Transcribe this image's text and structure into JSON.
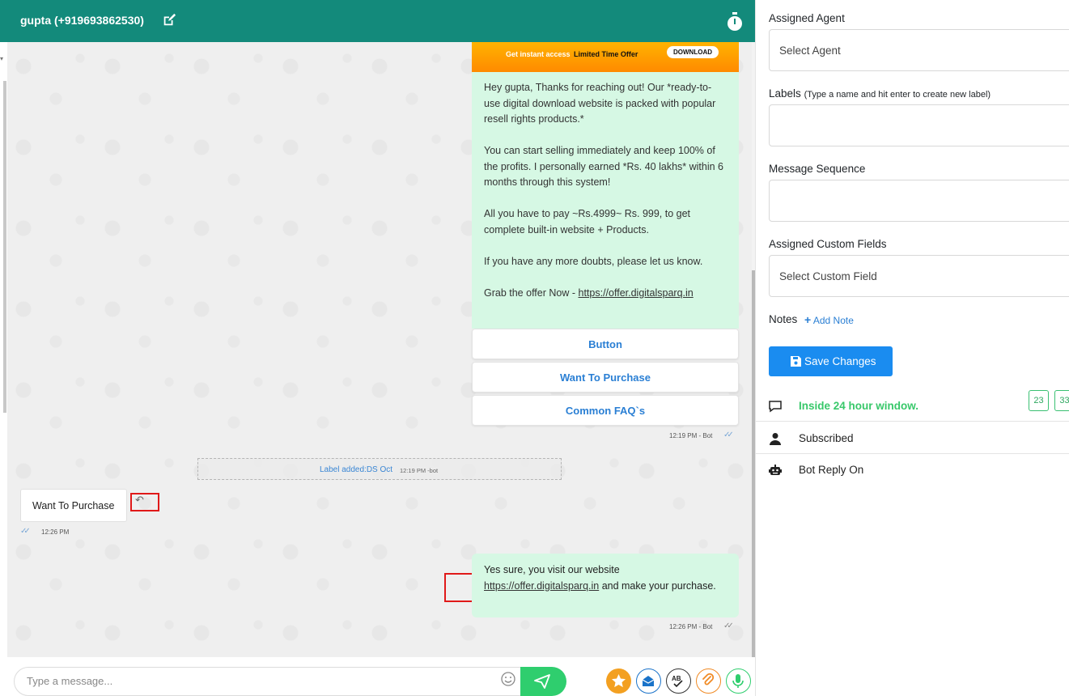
{
  "header": {
    "contact": "gupta (+919693862530)",
    "edit_icon": "edit-icon",
    "timer_icon": "stopwatch-icon"
  },
  "bot_template": {
    "banner_left": "Get instant access",
    "banner_mid": "Limited Time Offer",
    "banner_button": "DOWNLOAD",
    "para1": "Hey gupta, Thanks for reaching out! Our *ready-to-use digital download website is packed with popular resell rights products.*",
    "para2": "You can start selling immediately and keep 100% of the profits. I personally earned *Rs. 40 lakhs* within 6 months through this system!",
    "para3": "All you have to pay ~Rs.4999~ Rs. 999, to get complete built-in website + Products.",
    "para4": "If you have any more doubts, please let us know.",
    "para5_prefix": "Grab the offer Now - ",
    "para5_link": "https://offer.digitalsparq.in",
    "buttons": [
      "Button",
      "Want To Purchase",
      "Common FAQ`s"
    ],
    "time": "12:19 PM - Bot"
  },
  "label_note": {
    "text": "Label added:DS Oct",
    "time": "12:19 PM -bot"
  },
  "incoming": {
    "text": "Want To Purchase",
    "time": "12:26 PM"
  },
  "outgoing": {
    "prefix": "Yes sure, you visit our website ",
    "link": "https://offer.digitalsparq.in",
    "suffix": " and make your purchase.",
    "time": "12:26 PM - Bot"
  },
  "composer": {
    "placeholder": "Type a message..."
  },
  "sidebar": {
    "assigned_agent_label": "Assigned Agent",
    "assigned_agent_value": "Select Agent",
    "labels_label": "Labels",
    "labels_hint": "(Type a name and hit enter to create new label)",
    "message_sequence_label": "Message Sequence",
    "custom_fields_label": "Assigned Custom Fields",
    "custom_fields_value": "Select Custom Field",
    "notes_label": "Notes",
    "add_note": "Add Note",
    "save_button": "Save Changes",
    "window_status": "Inside 24 hour window.",
    "count1": "23",
    "count2": "33",
    "subscribed": "Subscribed",
    "bot_reply": "Bot Reply On"
  },
  "colors": {
    "header": "#138a7b",
    "bubble": "#d6f8e4",
    "accent_blue": "#1a8cf0",
    "green": "#2fce6e"
  }
}
